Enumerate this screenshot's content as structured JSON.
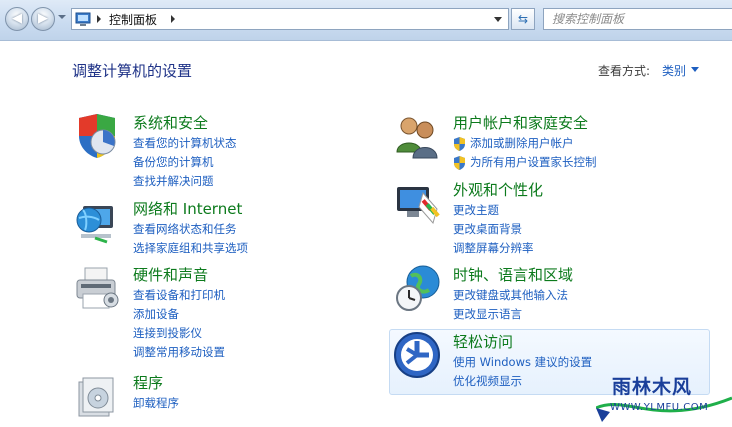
{
  "address_bar": {
    "breadcrumb": "控制面板",
    "search_placeholder": "搜索控制面板"
  },
  "page": {
    "title": "调整计算机的设置",
    "view_by_label": "查看方式:",
    "view_by_value": "类别"
  },
  "categories": {
    "system": {
      "title": "系统和安全",
      "links": [
        "查看您的计算机状态",
        "备份您的计算机",
        "查找并解决问题"
      ]
    },
    "network": {
      "title": "网络和 Internet",
      "links": [
        "查看网络状态和任务",
        "选择家庭组和共享选项"
      ]
    },
    "hardware": {
      "title": "硬件和声音",
      "links": [
        "查看设备和打印机",
        "添加设备",
        "连接到投影仪",
        "调整常用移动设置"
      ]
    },
    "programs": {
      "title": "程序",
      "links": [
        "卸载程序"
      ]
    },
    "users": {
      "title": "用户帐户和家庭安全",
      "links": [
        "添加或删除用户帐户",
        "为所有用户设置家长控制"
      ]
    },
    "appearance": {
      "title": "外观和个性化",
      "links": [
        "更改主题",
        "更改桌面背景",
        "调整屏幕分辨率"
      ]
    },
    "clock": {
      "title": "时钟、语言和区域",
      "links": [
        "更改键盘或其他输入法",
        "更改显示语言"
      ]
    },
    "ease": {
      "title": "轻松访问",
      "links": [
        "使用 Windows 建议的设置",
        "优化视频显示"
      ]
    }
  },
  "watermark": {
    "text": "雨林木风",
    "url": "WWW.YLMFU.COM"
  },
  "colors": {
    "category_title": "#0c7a1c",
    "link": "#1e5fc0",
    "page_title": "#1e3287"
  }
}
